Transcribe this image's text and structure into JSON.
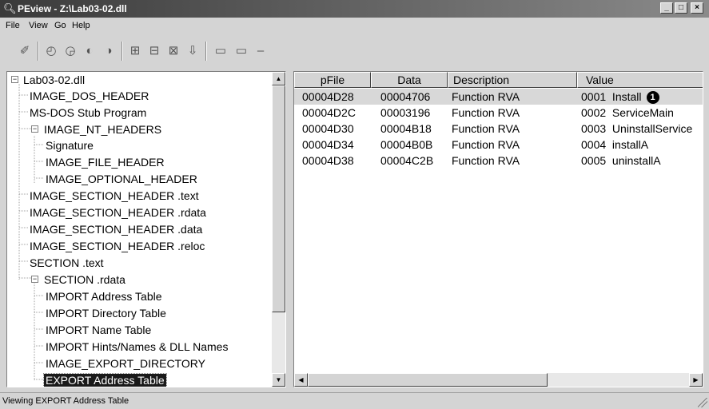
{
  "window": {
    "title": "PEview - Z:\\Lab03-02.dll",
    "buttons": [
      "_",
      "□",
      "×"
    ]
  },
  "menu": [
    "File",
    "View",
    "Go",
    "Help"
  ],
  "toolbar": {
    "icons": [
      "open-icon",
      "up-icon",
      "down-icon",
      "back-icon",
      "forward-icon",
      "view1-icon",
      "view2-icon",
      "view3-icon",
      "view4-icon",
      "mode1-icon",
      "mode2-icon",
      "mode3-icon"
    ]
  },
  "tree": {
    "items": [
      {
        "label": "Lab03-02.dll",
        "expander": "−"
      },
      {
        "label": "IMAGE_DOS_HEADER"
      },
      {
        "label": "MS-DOS Stub Program"
      },
      {
        "label": "IMAGE_NT_HEADERS",
        "expander": "−"
      },
      {
        "label": "Signature"
      },
      {
        "label": "IMAGE_FILE_HEADER"
      },
      {
        "label": "IMAGE_OPTIONAL_HEADER"
      },
      {
        "label": "IMAGE_SECTION_HEADER .text"
      },
      {
        "label": "IMAGE_SECTION_HEADER .rdata"
      },
      {
        "label": "IMAGE_SECTION_HEADER .data"
      },
      {
        "label": "IMAGE_SECTION_HEADER .reloc"
      },
      {
        "label": "SECTION .text"
      },
      {
        "label": "SECTION .rdata",
        "expander": "−"
      },
      {
        "label": "IMPORT Address Table"
      },
      {
        "label": "IMPORT Directory Table"
      },
      {
        "label": "IMPORT Name Table"
      },
      {
        "label": "IMPORT Hints/Names & DLL Names"
      },
      {
        "label": "IMAGE_EXPORT_DIRECTORY"
      },
      {
        "label": "EXPORT Address Table",
        "selected": true
      }
    ]
  },
  "list": {
    "columns": [
      "pFile",
      "Data",
      "Description",
      "Value"
    ],
    "rows": [
      {
        "pfile": "00004D28",
        "data": "00004706",
        "desc": "Function RVA",
        "value": "0001  Install",
        "callout": "1"
      },
      {
        "pfile": "00004D2C",
        "data": "00003196",
        "desc": "Function RVA",
        "value": "0002  ServiceMain"
      },
      {
        "pfile": "00004D30",
        "data": "00004B18",
        "desc": "Function RVA",
        "value": "0003  UninstallService"
      },
      {
        "pfile": "00004D34",
        "data": "00004B0B",
        "desc": "Function RVA",
        "value": "0004  installA"
      },
      {
        "pfile": "00004D38",
        "data": "00004C2B",
        "desc": "Function RVA",
        "value": "0005  uninstallA"
      }
    ]
  },
  "status": {
    "text": "Viewing EXPORT Address Table"
  }
}
